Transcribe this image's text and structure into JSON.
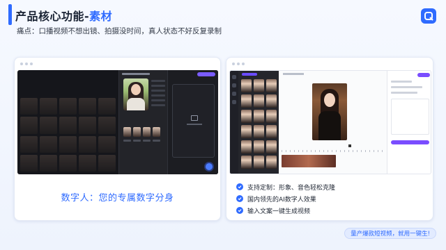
{
  "header": {
    "title_prefix": "产品核心功能-",
    "title_accent": "素材",
    "subtitle": "痛点：口播视频不想出镜、拍摄没时间，真人状态不好反复录制"
  },
  "left_card": {
    "caption": "数字人：您的专属数字分身"
  },
  "right_card": {
    "features": [
      "支持定制：形象、音色轻松克隆",
      "国内领先的AI数字人效果",
      "输入文案一键生成视频"
    ]
  },
  "cta": {
    "text": "量产爆款短视频，就用一键生!"
  },
  "colors": {
    "accent": "#2f6bff",
    "purple": "#7a4dff"
  }
}
